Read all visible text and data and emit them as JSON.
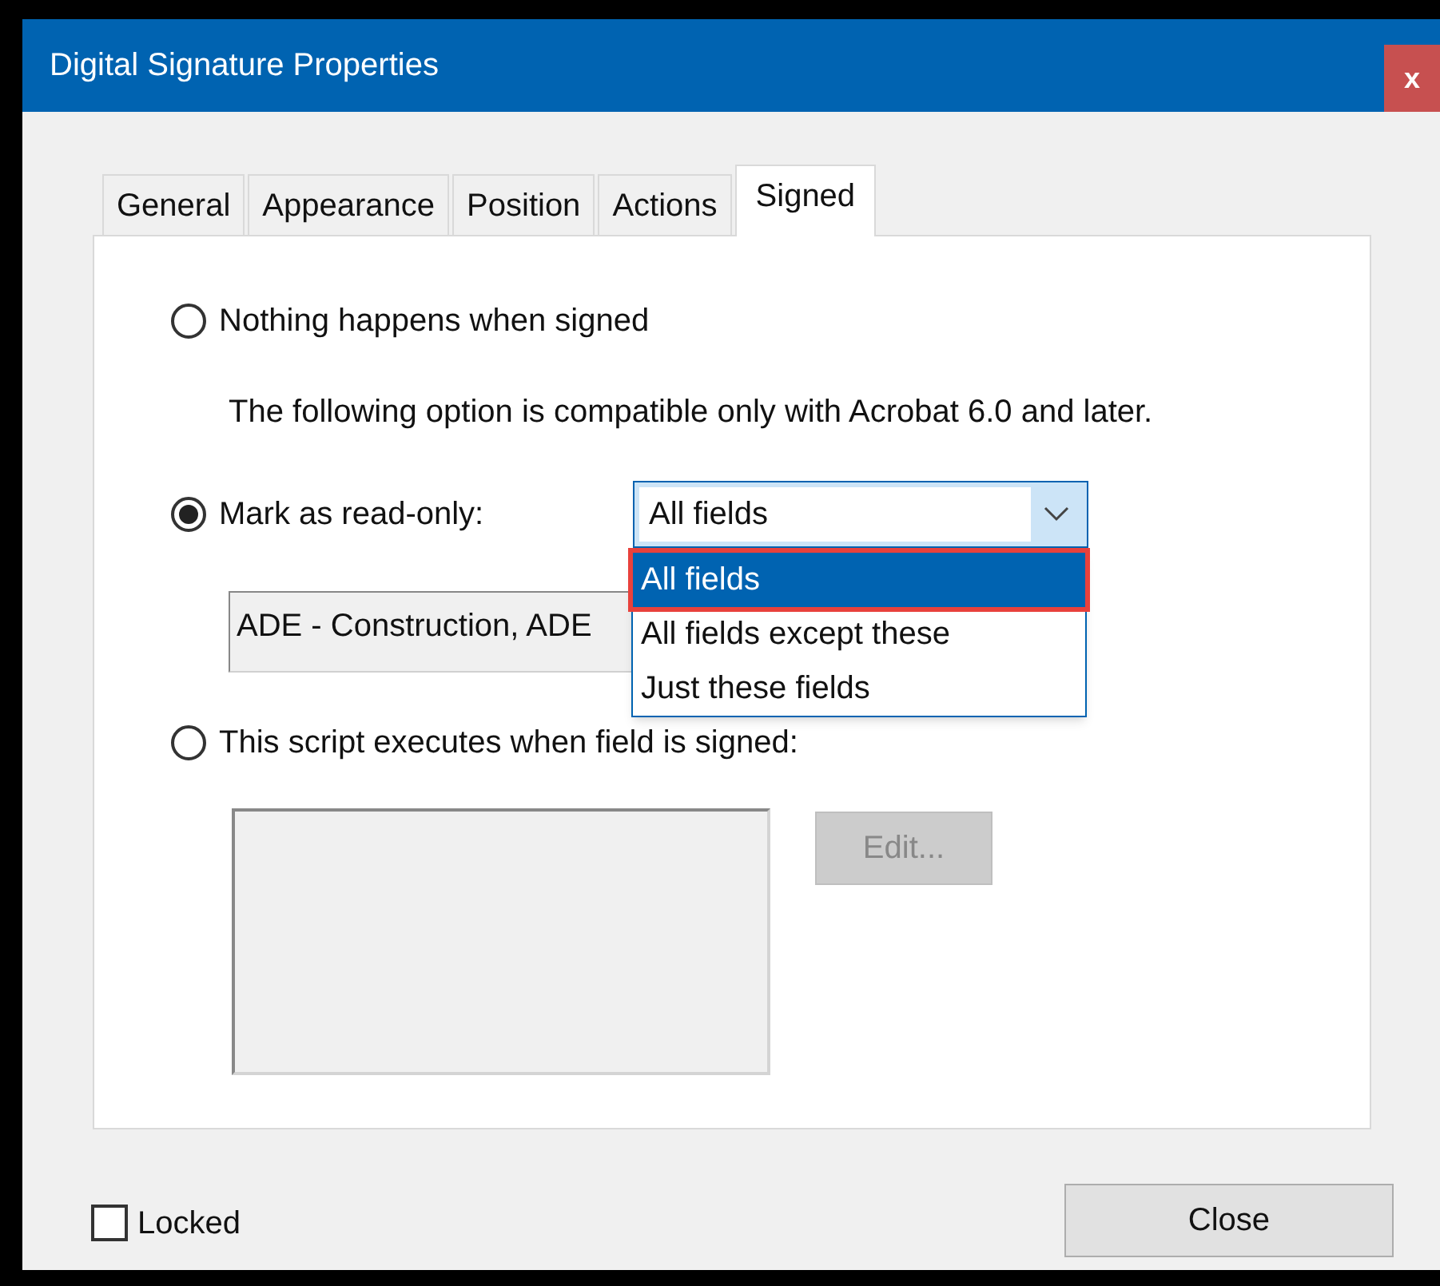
{
  "window": {
    "title": "Digital Signature Properties",
    "close_label": "x"
  },
  "tabs": [
    {
      "label": "General",
      "selected": false
    },
    {
      "label": "Appearance",
      "selected": false
    },
    {
      "label": "Position",
      "selected": false
    },
    {
      "label": "Actions",
      "selected": false
    },
    {
      "label": "Signed",
      "selected": true
    }
  ],
  "nothing_option": {
    "label": "Nothing happens when signed",
    "selected": false
  },
  "compat_note": "The following option is compatible only with Acrobat 6.0 and later.",
  "read_only_option": {
    "label": "Mark as read-only:",
    "selected": true
  },
  "read_only_scope": {
    "value": "All fields",
    "expanded": true,
    "options": [
      {
        "label": "All fields",
        "selected": true,
        "highlighted": true
      },
      {
        "label": "All fields except these",
        "selected": false,
        "highlighted": false
      },
      {
        "label": "Just these fields",
        "selected": false,
        "highlighted": false
      }
    ]
  },
  "field_list": {
    "value": "ADE - Construction, ADE"
  },
  "script_option": {
    "label": "This script executes when field is signed:",
    "selected": false
  },
  "edit_button": {
    "label": "Edit...",
    "disabled": true
  },
  "locked": {
    "label": "Locked",
    "checked": false
  },
  "close_button": {
    "label": "Close"
  }
}
